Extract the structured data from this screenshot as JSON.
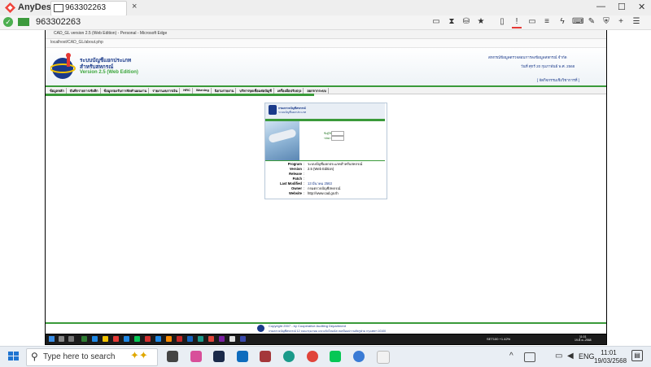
{
  "anydesk": {
    "brand": "AnyDesk",
    "tab_label": "963302263",
    "tab_close": "×",
    "remote_id": "963302263",
    "win_min": "—",
    "win_max": "☐",
    "win_close": "✕",
    "check": "✓"
  },
  "remote": {
    "edge_title": "CAD_GL version 2.5 (Web Edition) - Personal - Microsoft Edge",
    "url": "localhost/CAD_GL/about.php",
    "system": {
      "title": "ระบบบัญชีแยกประเภท",
      "subtitle": "สำหรับสหกรณ์",
      "version": "Version 2.5 (Web Edition)"
    },
    "header_right": {
      "dept": "สหกรณ์ข้อมูลตรวจสอบการลงข้อมูลสหกรณ์ จำกัด",
      "date": "วันที่ ศุกร์ 20 กุมภาพันธ์ พ.ศ. 2568",
      "link": "[ จัดกิจกรรมเชิงวิชาการที่ ]"
    },
    "menu": [
      "ข้อมูลหลัก",
      "บันทึกรายการเชิงลึก",
      "ข้อมูลรองรับการจัดทำแผนงาน",
      "รายงานงบการเงิน",
      "HRC",
      "Warning",
      "นิยามรายงาน",
      "บริหารจุดเชื่อมต่อบัญชี",
      "เครื่องมือปรับปรุง",
      "ออกจากระบบ"
    ],
    "card": {
      "header_line1": "กรมตรวจบัญชีสหกรณ์",
      "header_line2": "ระบบบัญชีแยกประเภท",
      "label_user": "ชื่อผู้ใช้",
      "label_pass": "รหัสผ่าน",
      "info": [
        {
          "key": "Program",
          "value": "ระบบบัญชีแยกประเภทสำหรับสหกรณ์"
        },
        {
          "key": "Version",
          "value": "2.5 (Web Edition)"
        },
        {
          "key": "Release",
          "value": ""
        },
        {
          "key": "Patch",
          "value": ""
        },
        {
          "key": "Last Modified",
          "value": "13 มีนาคม 2563"
        },
        {
          "key": "Owner",
          "value": "กรมตรวจบัญชีสหกรณ์"
        },
        {
          "key": "Website",
          "value": "http://www.cad.go.th"
        }
      ]
    },
    "footer": {
      "line1": "Copyright 2007 - by Cooperative Auditing Department",
      "line2": "กรมตรวจบัญชีสหกรณ์ 12 ถนนกรุงเกษม แขวงวัดโสมนัส เขตป้อมปราบศัตรูพ่าย กรุงเทพฯ 10100"
    },
    "taskbar": {
      "tray": "SET100 +1.42%",
      "time": "11:01",
      "date": "19-มี.ค.-2568"
    }
  },
  "taskbar": {
    "search_placeholder": "Type here to search",
    "lang": "ENG",
    "time": "11:01",
    "date": "19/03/2568",
    "apps": [
      {
        "name": "task-view",
        "color": "#444444"
      },
      {
        "name": "store",
        "color": "#3a7bd5"
      },
      {
        "name": "color-app",
        "color": "#d84f9a"
      },
      {
        "name": "photoshop",
        "color": "#1b2a4a"
      },
      {
        "name": "outlook",
        "color": "#0f6cbd"
      },
      {
        "name": "access",
        "color": "#a4373a"
      },
      {
        "name": "edge",
        "color": "#1a9a8a"
      },
      {
        "name": "chrome",
        "color": "#e0443a"
      },
      {
        "name": "line",
        "color": "#06c755"
      },
      {
        "name": "photos",
        "color": "#3a7bd5"
      },
      {
        "name": "files",
        "color": "#f2f2f2"
      }
    ]
  }
}
